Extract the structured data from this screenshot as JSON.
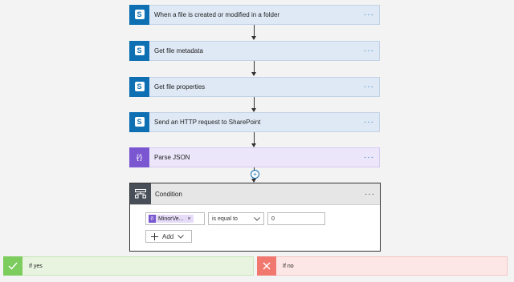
{
  "steps": [
    {
      "label": "When a file is created or modified in a folder",
      "icon": "sharepoint-icon",
      "more": "···"
    },
    {
      "label": "Get file metadata",
      "icon": "sharepoint-icon",
      "more": "···"
    },
    {
      "label": "Get file properties",
      "icon": "sharepoint-icon",
      "more": "···"
    },
    {
      "label": "Send an HTTP request to SharePoint",
      "icon": "sharepoint-icon",
      "more": "···"
    },
    {
      "label": "Parse JSON",
      "icon": "data-operation-icon",
      "more": "···"
    }
  ],
  "sharepoint_glyph": "S",
  "json_glyph": "{⁄}",
  "add_step": "+",
  "condition": {
    "title": "Condition",
    "more": "···",
    "left_token": "MinorVe...",
    "remove": "×",
    "operator": "is equal to",
    "value": "0",
    "add_label": "Add"
  },
  "branches": {
    "yes": "If yes",
    "no": "If no"
  },
  "colors": {
    "sharepoint": "#0e6fb3",
    "data_operation": "#7a57d1",
    "condition": "#484f58",
    "yes": "#7ccc5e",
    "no": "#f0786f"
  }
}
